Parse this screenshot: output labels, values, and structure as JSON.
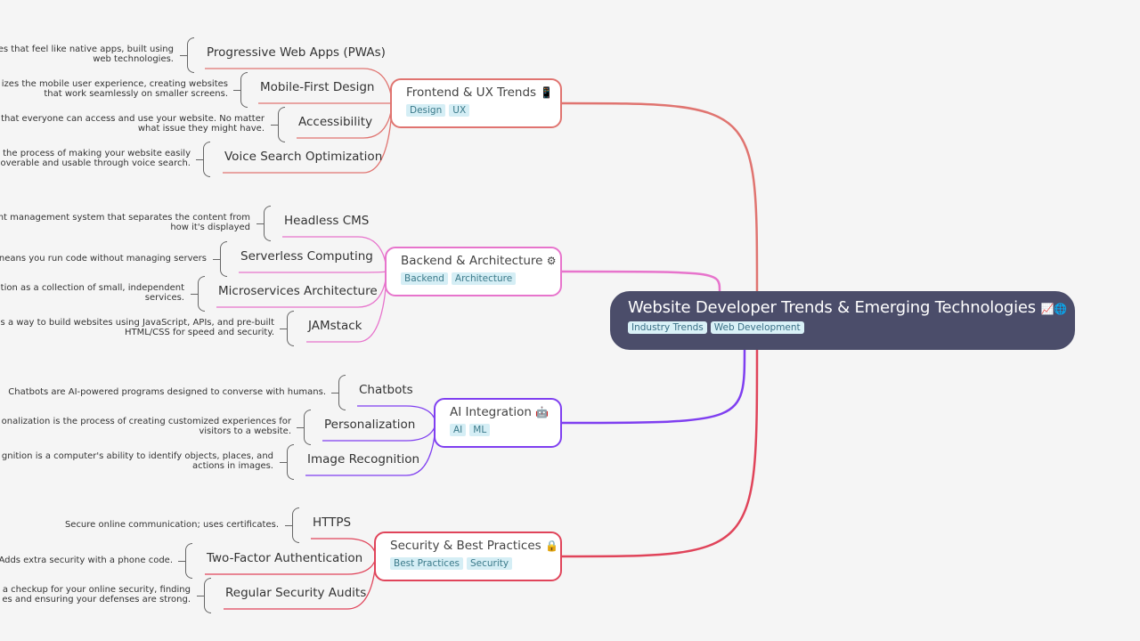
{
  "root": {
    "title": "Website Developer Trends & Emerging Technologies",
    "emoji": "📈🌐",
    "tags": [
      "Industry Trends",
      "Web Development"
    ]
  },
  "branches": [
    {
      "title": "Frontend & UX Trends",
      "emoji": "📱",
      "color": "#e07470",
      "tags": [
        "Design",
        "UX"
      ],
      "children": [
        {
          "label": "Progressive Web Apps (PWAs)",
          "note": [
            "es that feel like native apps, built using",
            "web technologies."
          ]
        },
        {
          "label": "Mobile-First Design",
          "note": [
            "izes the mobile user experience, creating websites",
            "that work seamlessly on smaller screens."
          ]
        },
        {
          "label": "Accessibility",
          "note": [
            "that everyone can access and use your website. No matter",
            "what issue they might have."
          ]
        },
        {
          "label": "Voice Search Optimization",
          "note": [
            "the process of making your website easily",
            "overable and usable through voice search."
          ]
        }
      ]
    },
    {
      "title": "Backend & Architecture",
      "emoji": "⚙",
      "color": "#e774cc",
      "tags": [
        "Backend",
        "Architecture"
      ],
      "children": [
        {
          "label": "Headless CMS",
          "note": [
            "nt management system that separates the content from",
            "how it's displayed"
          ]
        },
        {
          "label": "Serverless Computing",
          "note": [
            "neans you run code without managing servers"
          ]
        },
        {
          "label": "Microservices Architecture",
          "note": [
            "tion as a collection of small, independent",
            "services."
          ]
        },
        {
          "label": "JAMstack",
          "note": [
            "is a way to build websites using JavaScript, APIs, and pre-built",
            "HTML/CSS for speed and security."
          ]
        }
      ]
    },
    {
      "title": "AI Integration",
      "emoji": "🤖",
      "color": "#7f3ff0",
      "tags": [
        "AI",
        "ML"
      ],
      "children": [
        {
          "label": "Chatbots",
          "note": [
            "Chatbots are AI-powered programs designed to converse with humans."
          ]
        },
        {
          "label": "Personalization",
          "note": [
            "onalization is the process of creating customized experiences for",
            "visitors to a website."
          ]
        },
        {
          "label": "Image Recognition",
          "note": [
            "gnition is a computer's ability to identify objects, places, and",
            "actions in images."
          ]
        }
      ]
    },
    {
      "title": "Security & Best Practices",
      "emoji": "🔒",
      "color": "#e0445a",
      "tags": [
        "Best Practices",
        "Security"
      ],
      "children": [
        {
          "label": "HTTPS",
          "note": [
            "Secure online communication; uses certificates."
          ]
        },
        {
          "label": "Two-Factor Authentication",
          "note": [
            "Adds extra security with a phone code."
          ]
        },
        {
          "label": "Regular Security Audits",
          "note": [
            "a checkup for your online security, finding",
            "es and ensuring your defenses are strong."
          ]
        }
      ]
    }
  ]
}
